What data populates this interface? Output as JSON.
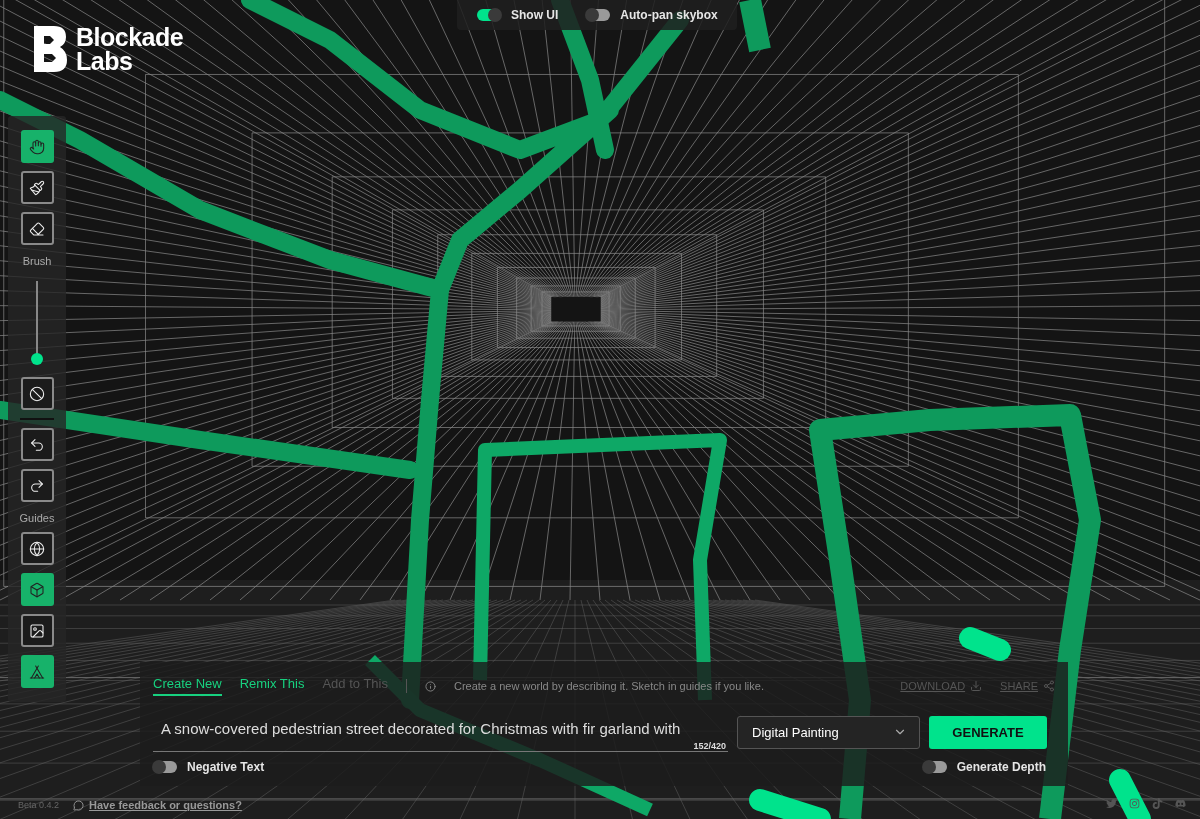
{
  "logo": {
    "lines": [
      "Blockade",
      "Labs"
    ]
  },
  "top_toggles": [
    {
      "label": "Show UI",
      "on": true
    },
    {
      "label": "Auto-pan skybox",
      "on": false
    }
  ],
  "toolbar": [
    {
      "kind": "tool",
      "selected": true
    },
    {
      "kind": "tool",
      "selected": false
    },
    {
      "kind": "tool",
      "selected": false
    },
    {
      "kind": "label",
      "text": "Brush"
    },
    {
      "kind": "slider",
      "level": 0.05
    },
    {
      "kind": "tool",
      "selected": false
    },
    {
      "kind": "divider"
    },
    {
      "kind": "tool",
      "selected": false
    },
    {
      "kind": "tool",
      "selected": false
    },
    {
      "kind": "label",
      "text": "Guides"
    },
    {
      "kind": "tool",
      "selected": false
    },
    {
      "kind": "tool",
      "selected": true
    },
    {
      "kind": "tool",
      "selected": false
    },
    {
      "kind": "tool",
      "selected": true
    }
  ],
  "panel": {
    "tabs": [
      {
        "label": "Create New",
        "selected": true,
        "disabled": false
      },
      {
        "label": "Remix This",
        "selected": false,
        "disabled": false
      },
      {
        "label": "Add to This",
        "selected": false,
        "disabled": true
      }
    ],
    "hint": "Create a new world by describing it. Sketch in guides if you like.",
    "actions": [
      {
        "label": "DOWNLOAD",
        "disabled": true
      },
      {
        "label": "SHARE",
        "disabled": true
      }
    ],
    "prompt": {
      "value": "A snow-covered pedestrian street decorated for Christmas with fir garland with",
      "counter": "152/420"
    },
    "style_select": {
      "value": "Digital Painting"
    },
    "generate_button": "GENERATE",
    "toggles": [
      {
        "label": "Negative Text",
        "on": false
      },
      {
        "label": "Generate Depth",
        "on": false
      }
    ]
  },
  "footer": {
    "version": "Beta 0.4.2",
    "feedback_link": "Have feedback or questions?"
  }
}
